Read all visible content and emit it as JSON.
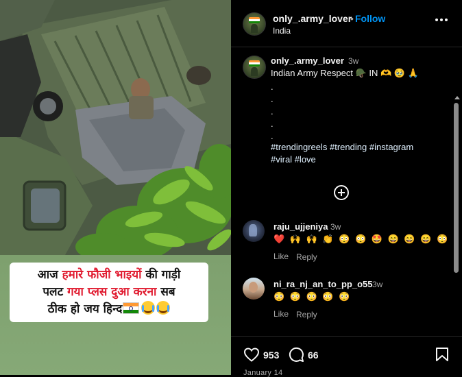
{
  "post": {
    "username": "only_.army_lover",
    "separator": "•",
    "follow_label": "Follow",
    "location": "India",
    "more_label": "More options"
  },
  "media": {
    "caption_lines": [
      {
        "pre": "आज ",
        "hl": "हमारे फौजी भाइयों",
        "post": " की गाड़ी"
      },
      {
        "pre": "पलट ",
        "hl": "गया प्लस दुआ करना",
        "post": " सब"
      },
      {
        "pre": "ठीक हो जय हिन्द",
        "hl": "",
        "post": ""
      }
    ]
  },
  "caption": {
    "username": "only_.army_lover",
    "time": "3w",
    "text": "Indian Army Respect 🪖 IN 🫶 🥹 🙏",
    "dots": [
      ".",
      ".",
      ".",
      ".",
      "."
    ],
    "hashtags_line1": [
      "#trendingreels",
      "#trending",
      "#instagram"
    ],
    "hashtags_line2": [
      "#viral",
      "#love"
    ]
  },
  "comments": [
    {
      "username": "raju_ujjeniya",
      "time": "3w",
      "text": "❤️ 🙌 🙌 👏 😳 😳 🤩 😄 😄 😄 😳",
      "like_label": "Like",
      "reply_label": "Reply"
    },
    {
      "username": "ni_ra_nj_an_to_pp_o55",
      "time": "3w",
      "text": "😳 😳 😳 😳 😳",
      "like_label": "Like",
      "reply_label": "Reply"
    }
  ],
  "actions": {
    "like_count": "953",
    "comment_count": "66",
    "date": "January 14"
  },
  "colors": {
    "accent": "#0095f6",
    "background": "#000000",
    "text": "#f5f5f5",
    "muted": "#a8a8a8",
    "hashtag": "#e0f1ff"
  }
}
